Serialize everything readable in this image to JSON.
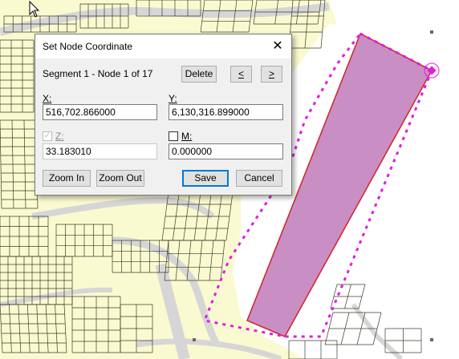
{
  "dialog": {
    "title": "Set Node Coordinate",
    "close_glyph": "✕",
    "segment_info": "Segment 1 - Node 1 of 17",
    "delete_label": "Delete",
    "prev_label": "<",
    "next_label": ">",
    "x": {
      "label": "X:",
      "value": "516,702.866000"
    },
    "y": {
      "label": "Y:",
      "value": "6,130,316.899000"
    },
    "z": {
      "label": "Z:",
      "value": "33.183010",
      "checked": true,
      "enabled": false
    },
    "m": {
      "label": "M:",
      "value": "0.000000",
      "checked": false
    },
    "zoom_in_label": "Zoom In",
    "zoom_out_label": "Zoom Out",
    "save_label": "Save",
    "cancel_label": "Cancel"
  },
  "map": {
    "colors": {
      "land": "#fafad0",
      "water": "#ffffff",
      "road": "#d6d6d6",
      "parcel_line": "#3b3b2e",
      "polygon_fill": "#c98ec3",
      "polygon_edge": "#d2232a",
      "sketch_line": "#e01ee0"
    }
  }
}
